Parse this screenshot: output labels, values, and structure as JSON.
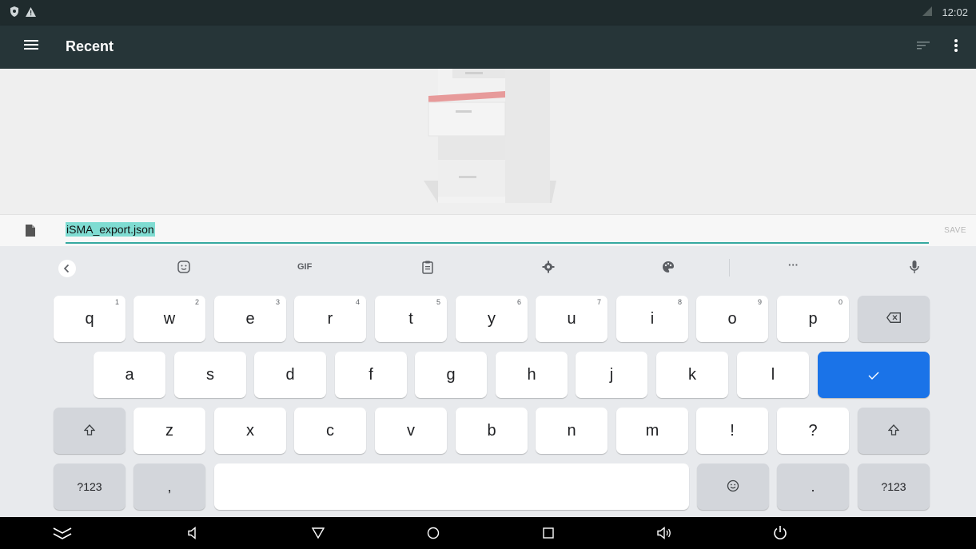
{
  "status_bar": {
    "time": "12:02"
  },
  "app_bar": {
    "title": "Recent"
  },
  "file_row": {
    "filename": "iSMA_export.json",
    "save_label": "SAVE"
  },
  "keyboard": {
    "toolbar": {
      "gif_label": "GIF",
      "more_label": "···"
    },
    "number_hints": [
      "1",
      "2",
      "3",
      "4",
      "5",
      "6",
      "7",
      "8",
      "9",
      "0"
    ],
    "row1": [
      "q",
      "w",
      "e",
      "r",
      "t",
      "y",
      "u",
      "i",
      "o",
      "p"
    ],
    "row2": [
      "a",
      "s",
      "d",
      "f",
      "g",
      "h",
      "j",
      "k",
      "l"
    ],
    "row3": [
      "z",
      "x",
      "c",
      "v",
      "b",
      "n",
      "m",
      "!",
      "?"
    ],
    "symbols_label": "?123",
    "comma": ",",
    "period": "."
  },
  "colors": {
    "status_bar": "#1f2b2d",
    "app_bar": "#263538",
    "accent": "#35a9a0",
    "enter_key": "#1a73e8"
  }
}
